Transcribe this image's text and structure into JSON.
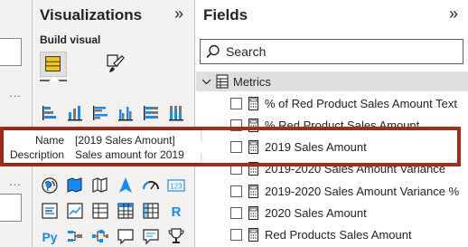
{
  "visualizations": {
    "title": "Visualizations",
    "build_label": "Build visual"
  },
  "fields_pane": {
    "title": "Fields",
    "search_placeholder": "Search",
    "table": {
      "name": "Metrics",
      "fields": [
        "% of Red Product Sales Amount Text",
        "% Red Product Sales Amount",
        "2019 Sales Amount",
        "2019-2020 Sales Amount Variance",
        "2019-2020 Sales Amount Variance %",
        "2020 Sales Amount",
        "Red Products Sales Amount"
      ]
    }
  },
  "tooltip": {
    "name_key": "Name",
    "name_value": "[2019 Sales Amount]",
    "description_key": "Description",
    "description_value": "Sales amount for 2019"
  },
  "colors": {
    "pane_bg": "#f3f2f1",
    "highlight_border": "#a12d1b",
    "table_header_bg": "#e1dfdd",
    "accent_blue": "#118dff"
  }
}
